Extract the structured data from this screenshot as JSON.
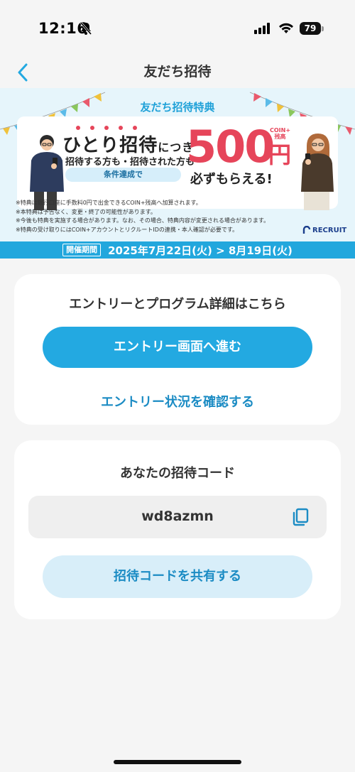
{
  "status_bar": {
    "time": "12:16",
    "battery": "79"
  },
  "nav": {
    "title": "友だち招待",
    "back_icon": "chevron-left-icon"
  },
  "banner": {
    "heading": "友だち招待特典",
    "hitori": "ひとり招待",
    "hitori_suffix": "につき",
    "sub_line": "招待する方も・招待された方も",
    "condition": "条件達成で",
    "amount": "500",
    "coin_label_1": "COIN+",
    "coin_label_2": "残高",
    "yen": "円",
    "kanarazu": "必ずもらえる!",
    "notes": [
      "※特典は銀行口座に手数料0円で出金できるCOIN+残高へ加算されます。",
      "※本特典は予告なく、変更・終了の可能性があります。",
      "※今後も特典を実施する場合があります。なお、その場合、特典内容が変更される場合があります。",
      "※特典の受け取りにはCOIN+アカウントとリクルートIDの連携・本人確認が必要です。"
    ],
    "recruit_logo": "RECRUIT",
    "period_tag": "開催期間",
    "period_text": "2025年7月22日(火) > 8月19日(火)"
  },
  "entry_card": {
    "title": "エントリーとプログラム詳細はこちら",
    "entry_button": "エントリー画面へ進む",
    "status_link": "エントリー状況を確認する"
  },
  "invite_card": {
    "title": "あなたの招待コード",
    "code": "wd8azmn",
    "share_button": "招待コードを共有する"
  },
  "colors": {
    "accent": "#23a9e1",
    "link": "#1c8cc4",
    "highlight": "#e6455a"
  }
}
